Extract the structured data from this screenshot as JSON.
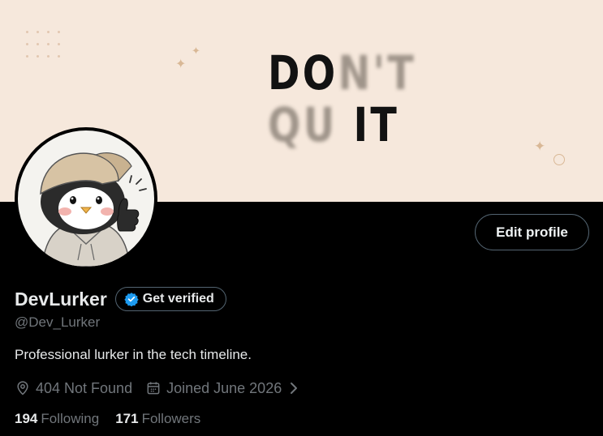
{
  "banner": {
    "quote_line1_sharp": "DO",
    "quote_line1_blur": "N'T",
    "quote_line2_blur": "QU",
    "quote_line2_sharp": "IT",
    "colors": {
      "background": "#f6e8dc",
      "accent": "#d9b896"
    }
  },
  "profile": {
    "display_name": "DevLurker",
    "verify_label": "Get verified",
    "handle": "@Dev_Lurker",
    "bio": "Professional lurker in the tech timeline.",
    "location": "404 Not Found",
    "joined": "Joined June 2026",
    "edit_label": "Edit profile",
    "following_count": "194",
    "following_label": "Following",
    "followers_count": "171",
    "followers_label": "Followers"
  },
  "icons": {
    "location": "location-pin-icon",
    "calendar": "calendar-icon",
    "chevron": "chevron-right-icon",
    "verified": "verified-badge-icon"
  },
  "colors": {
    "background": "#000000",
    "text_primary": "#e7e9ea",
    "text_secondary": "#71767b",
    "border": "#536471",
    "verified_blue": "#1d9bf0"
  }
}
